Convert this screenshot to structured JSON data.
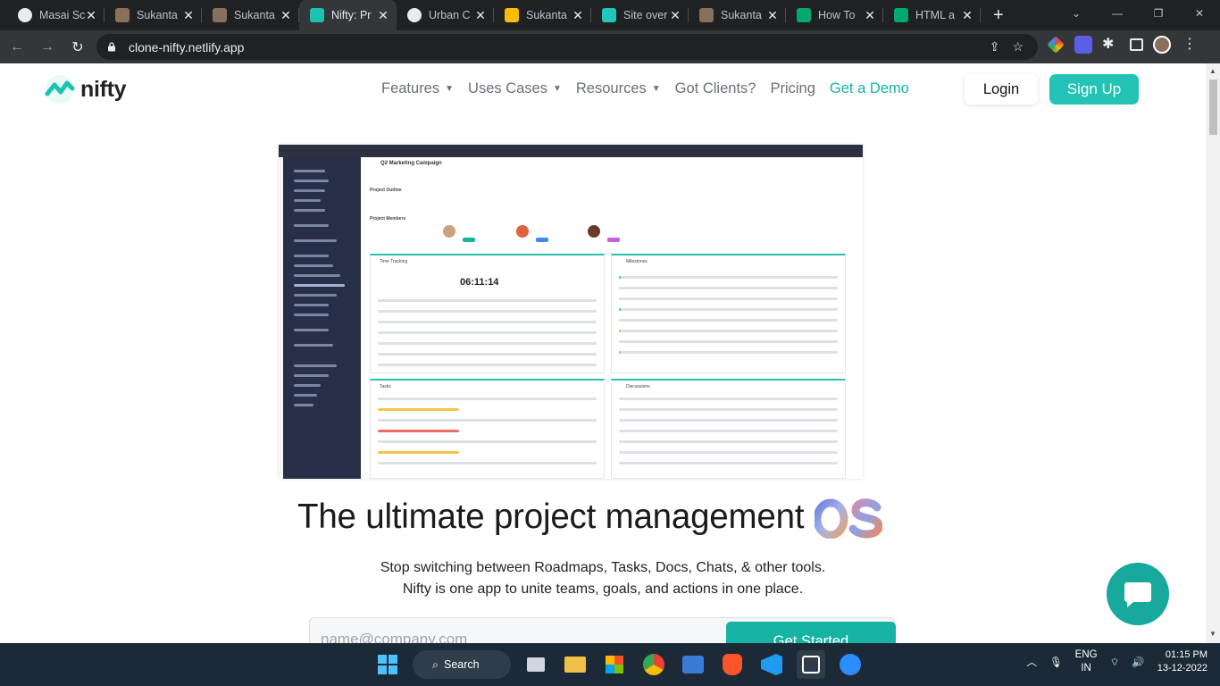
{
  "browser": {
    "tabs": [
      {
        "title": "Masai Sc",
        "icon": "github-icon",
        "active": false
      },
      {
        "title": "Sukanta",
        "icon": "avatar-icon",
        "active": false
      },
      {
        "title": "Sukanta",
        "icon": "avatar-icon",
        "active": false
      },
      {
        "title": "Nifty: Pr",
        "icon": "nifty-icon",
        "active": true
      },
      {
        "title": "Urban C",
        "icon": "github-icon",
        "active": false
      },
      {
        "title": "Sukanta",
        "icon": "drive-icon",
        "active": false
      },
      {
        "title": "Site over",
        "icon": "netlify-icon",
        "active": false
      },
      {
        "title": "Sukanta",
        "icon": "avatar-icon",
        "active": false
      },
      {
        "title": "How To",
        "icon": "w3schools-icon",
        "active": false
      },
      {
        "title": "HTML a",
        "icon": "w3schools-icon",
        "active": false
      }
    ],
    "url": "clone-nifty.netlify.app"
  },
  "site": {
    "brand": "nifty",
    "nav": {
      "features": "Features",
      "use_cases": "Uses Cases",
      "resources": "Resources",
      "clients": "Got Clients?",
      "pricing": "Pricing",
      "demo": "Get a Demo"
    },
    "login": "Login",
    "signup": "Sign Up",
    "headline": "The ultimate project management",
    "sub1": "Stop switching between Roadmaps, Tasks, Docs, Chats, & other tools.",
    "sub2": "Nifty is one app to unite teams, goals, and actions in one place.",
    "email_placeholder": "name@company.com",
    "cta": "Get Started",
    "accent": "#22c3b4"
  },
  "preview": {
    "project": "Q2 Marketing Campaign",
    "outline": "Project Outline",
    "members": "Project Members",
    "time_tracking": "Time Tracking",
    "timer": "06:11:14",
    "milestones": "Milestones",
    "tasks": "Tasks",
    "discussions": "Discussions"
  },
  "taskbar": {
    "search": "Search",
    "lang_line1": "ENG",
    "lang_line2": "IN",
    "time": "01:15 PM",
    "date": "13-12-2022"
  }
}
